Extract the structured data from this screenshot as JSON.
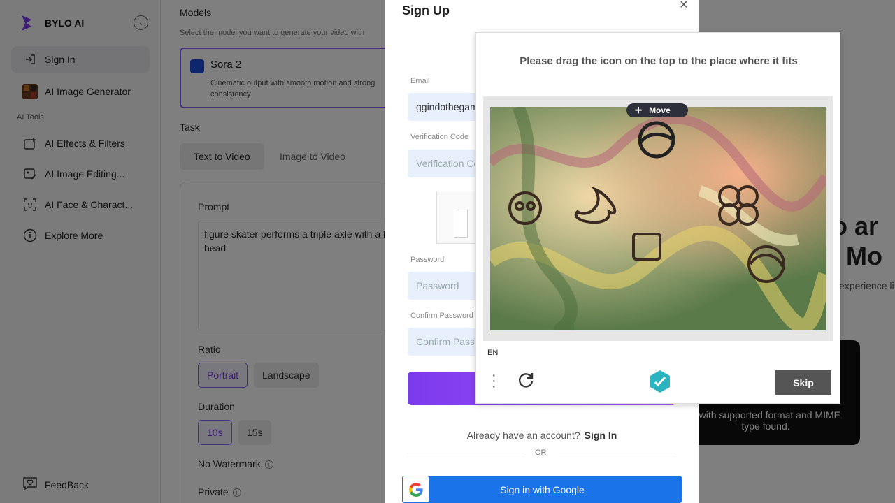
{
  "sidebar": {
    "brand": "BYLO AI",
    "items": [
      {
        "label": "Sign In"
      },
      {
        "label": "AI Image Generator"
      }
    ],
    "section_label": "AI Tools",
    "tools": [
      {
        "label": "AI Effects & Filters"
      },
      {
        "label": "AI Image Editing..."
      },
      {
        "label": "AI Face & Charact..."
      },
      {
        "label": "Explore More"
      }
    ],
    "feedback": "FeedBack"
  },
  "main": {
    "models_title": "Models",
    "models_subtitle": "Select the model you want to generate your video with",
    "model_name": "Sora 2",
    "model_desc": "Cinematic output with smooth motion and strong consistency.",
    "task_label": "Task",
    "tabs": [
      {
        "label": "Text to Video"
      },
      {
        "label": "Image to Video"
      }
    ],
    "prompt_label": "Prompt",
    "prompt_value": "figure skater performs a triple axle with a her head",
    "ratio_label": "Ratio",
    "ratio_options": [
      {
        "label": "Portrait"
      },
      {
        "label": "Landscape"
      }
    ],
    "duration_label": "Duration",
    "duration_options": [
      {
        "label": "10s"
      },
      {
        "label": "15s"
      }
    ],
    "no_watermark": "No Watermark",
    "private": "Private",
    "hero_title_1": "eo ar",
    "hero_title_2": "ic Mo",
    "hero_sub": "experience li",
    "video_error_1": "o with supported format and MIME",
    "video_error_2": "type found."
  },
  "signup": {
    "title": "Sign Up",
    "close": "×",
    "email_label": "Email",
    "email_value": "ggindothegam",
    "vcode_label": "Verification Code",
    "vcode_placeholder": "Verification Co",
    "password_label": "Password",
    "password_placeholder": "Password",
    "confirm_label": "Confirm Password",
    "confirm_placeholder": "Confirm Pass",
    "have_account": "Already have an account?",
    "signin_link": "Sign In",
    "or": "OR",
    "google_label": "Sign in with Google"
  },
  "captcha": {
    "prompt": "Please drag the icon on the top to the place where it fits",
    "move_label": "Move",
    "language": "EN",
    "skip_label": "Skip"
  }
}
